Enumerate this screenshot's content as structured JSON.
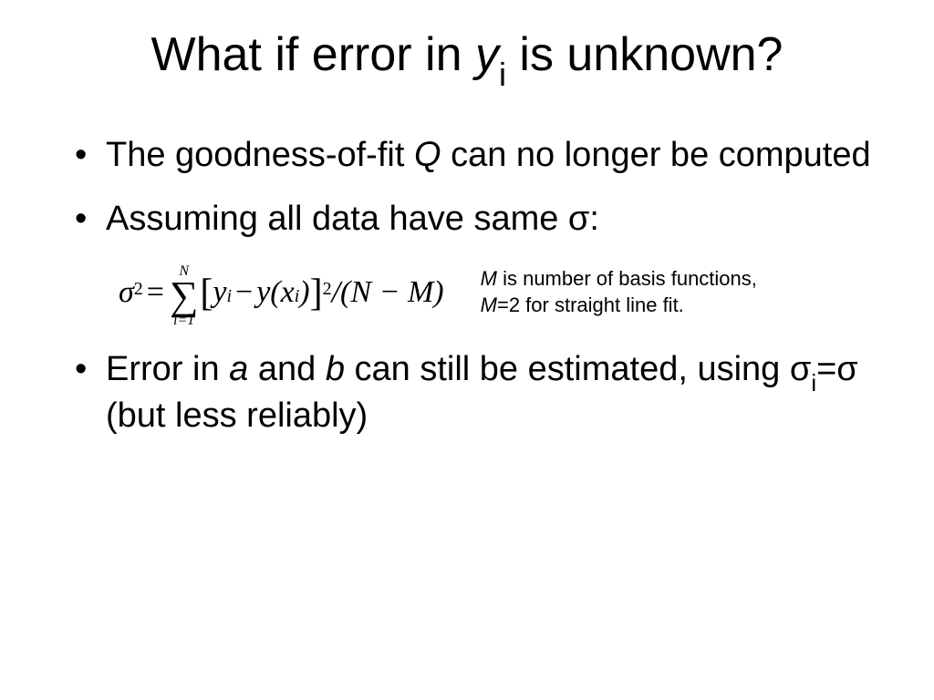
{
  "title": {
    "prefix": "What if error in ",
    "var": "y",
    "sub": "i",
    "suffix": " is unknown?"
  },
  "bullets": {
    "b1_prefix": "The goodness-of-fit ",
    "b1_var": "Q",
    "b1_suffix": " can no longer be computed",
    "b2": "Assuming all data have same σ:",
    "b3_prefix": "Error in ",
    "b3_a": "a",
    "b3_mid1": " and ",
    "b3_b": "b",
    "b3_mid2": " can still be estimated, using σ",
    "b3_sub": "i",
    "b3_suffix": "=σ  (but less reliably)"
  },
  "equation": {
    "sigma": "σ",
    "sigma_exp": "2",
    "eq": " = ",
    "sum_top": "N",
    "sum_sym": "∑",
    "sum_bot": "i=1",
    "lbrack": "[",
    "term_y": "y",
    "term_y_sub": "i",
    "minus": " − ",
    "term_yx_pre": "y(x",
    "term_yx_sub": "i",
    "term_yx_post": ")",
    "rbrack": "]",
    "outer_exp": "2",
    "tail": " /(N − M)"
  },
  "note": {
    "line1_var": "M",
    "line1_rest": " is number of basis functions,",
    "line2_var": "M",
    "line2_rest": "=2 for straight line fit."
  }
}
